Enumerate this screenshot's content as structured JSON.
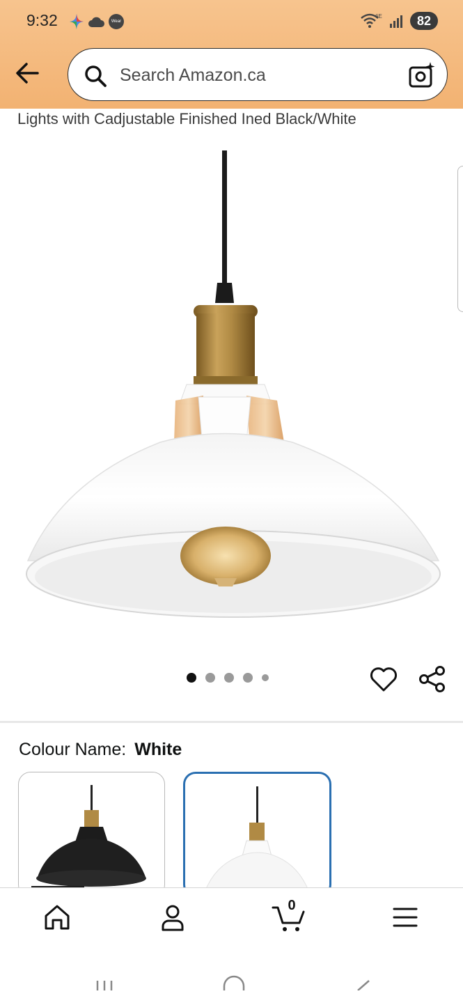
{
  "status_bar": {
    "time": "9:32",
    "battery": "82",
    "icons_left": [
      "gemini-sparkle-icon",
      "cloud-icon",
      "wear-icon"
    ],
    "icons_right": [
      "wifi-6e-icon",
      "signal-icon"
    ],
    "wear_label": "Wear",
    "wifi_label": "6E"
  },
  "header": {
    "search_placeholder": "Search Amazon.ca",
    "accent_color": "#f4b97d"
  },
  "product": {
    "title_fragment": "Lights with Cadjustable Finished Ined Black/White",
    "image_count": 5,
    "active_image_index": 0
  },
  "variation": {
    "label": "Colour Name:",
    "value": "White",
    "options": [
      {
        "name": "Black",
        "selected": false
      },
      {
        "name": "White",
        "selected": true
      }
    ],
    "selected_color": "#2a6fb1"
  },
  "bottom_nav": {
    "items": [
      "home-icon",
      "account-icon",
      "cart-icon",
      "menu-icon"
    ],
    "cart_count": "0"
  },
  "system_nav": [
    "recents-icon",
    "home-pill-icon",
    "back-icon"
  ]
}
